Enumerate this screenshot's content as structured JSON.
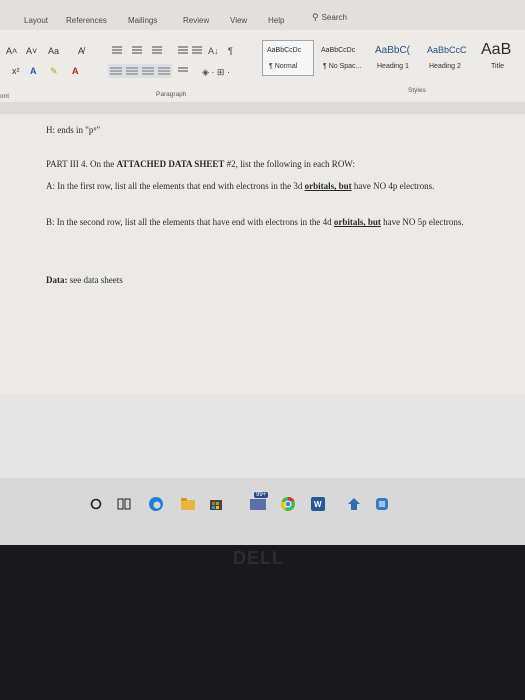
{
  "ribbon": {
    "tabs": [
      "Layout",
      "References",
      "Mailings",
      "Review",
      "View",
      "Help"
    ],
    "search_label": "Search",
    "font_tools_row1": [
      "A˄",
      "A˅",
      "Aa",
      "A̸"
    ],
    "font_tools_row2": [
      "x²",
      "A",
      "✎",
      "A"
    ],
    "styles": [
      {
        "sample": "AaBbCcDc",
        "name": "¶ Normal"
      },
      {
        "sample": "AaBbCcDc",
        "name": "¶ No Spac..."
      },
      {
        "sample": "AaBbC(",
        "name": "Heading 1"
      },
      {
        "sample": "AaBbCcC",
        "name": "Heading 2"
      },
      {
        "sample": "AaB",
        "name": "Title"
      }
    ],
    "group_labels": {
      "font": "ont",
      "paragraph": "Paragraph",
      "styles": "Styles"
    }
  },
  "document": {
    "line_h": "H: ends in \"p⁶\"",
    "part_prefix": "PART III 4. On the ",
    "part_bold": "ATTACHED DATA SHEET",
    "part_suffix": " #2, list the following in each ROW:",
    "a_text": "A: In the first row, list all the elements that end with electrons in the 3d ",
    "a_underlined": "orbitals, but",
    "a_suffix": " have NO 4p electrons.",
    "b_text": "B: In the second row, list all the elements that have end with electrons in the 4d ",
    "b_underlined": "orbitals, but",
    "b_suffix": " have NO 5p electrons.",
    "data_label": "Data:",
    "data_value": " see data sheets"
  },
  "taskbar": {
    "items": [
      "start-icon",
      "task-view-icon",
      "edge-icon",
      "file-explorer-icon",
      "store-icon",
      "mail-badge-icon",
      "chrome-icon",
      "word-icon",
      "app-icon",
      "app2-icon"
    ],
    "badge": "99+"
  },
  "bezel": {
    "logo": "DELL"
  }
}
